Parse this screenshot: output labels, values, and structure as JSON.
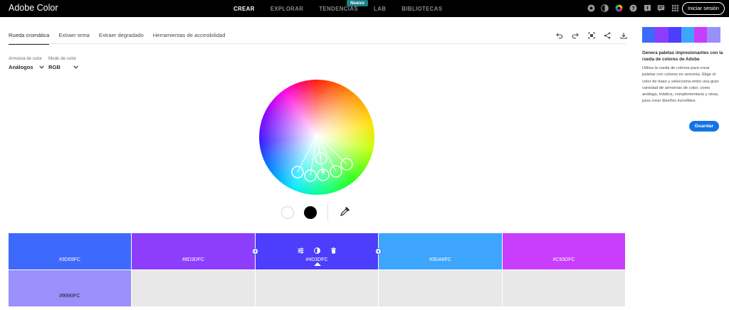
{
  "header": {
    "brand": "Adobe Color",
    "nav": [
      "CREAR",
      "EXPLORAR",
      "TENDENCIAS",
      "LAB",
      "BIBLIOTECAS"
    ],
    "lab_badge": "Nuevo",
    "signin_label": "Iniciar sesión",
    "icons": [
      "star-icon",
      "contrast-icon",
      "color-wheel-icon",
      "help-icon",
      "info-icon",
      "chat-icon",
      "apps-grid-icon"
    ]
  },
  "tabs": [
    "Rueda cromática",
    "Extraer tema",
    "Extraer degradado",
    "Herramientas de accesibilidad"
  ],
  "toolbar": {
    "icons": [
      "undo-icon",
      "redo-icon",
      "fullscreen-icon",
      "share-icon",
      "download-icon"
    ]
  },
  "controls": {
    "harmony_label": "Armonía de color",
    "harmony_value": "Análogos",
    "mode_label": "Modo de color",
    "mode_value": "RGB"
  },
  "palette": {
    "colors": [
      {
        "hex": "#3D69FC",
        "color": "#3d69fc"
      },
      {
        "hex": "#8D3DFC",
        "color": "#8d3dfc"
      },
      {
        "hex": "#4D3DFC",
        "color": "#4d3dfc"
      },
      {
        "hex": "#3DA6FC",
        "color": "#3da6fc"
      },
      {
        "hex": "#C93DFC",
        "color": "#c93dfc"
      },
      {
        "hex": "#9990FC",
        "color": "#9990fc"
      }
    ],
    "selected_index": 2
  },
  "side": {
    "title": "Genera paletas impresionantes con la rueda de colores de Adobe",
    "body": "Utiliza la rueda de colores para crear paletas con colores en armonía. Elige el color de base y selecciona entre una gran variedad de armonías de color, como análoga, triádica, complementaria y otras, para crear diseños increíbles.",
    "save_label": "Guardar"
  }
}
